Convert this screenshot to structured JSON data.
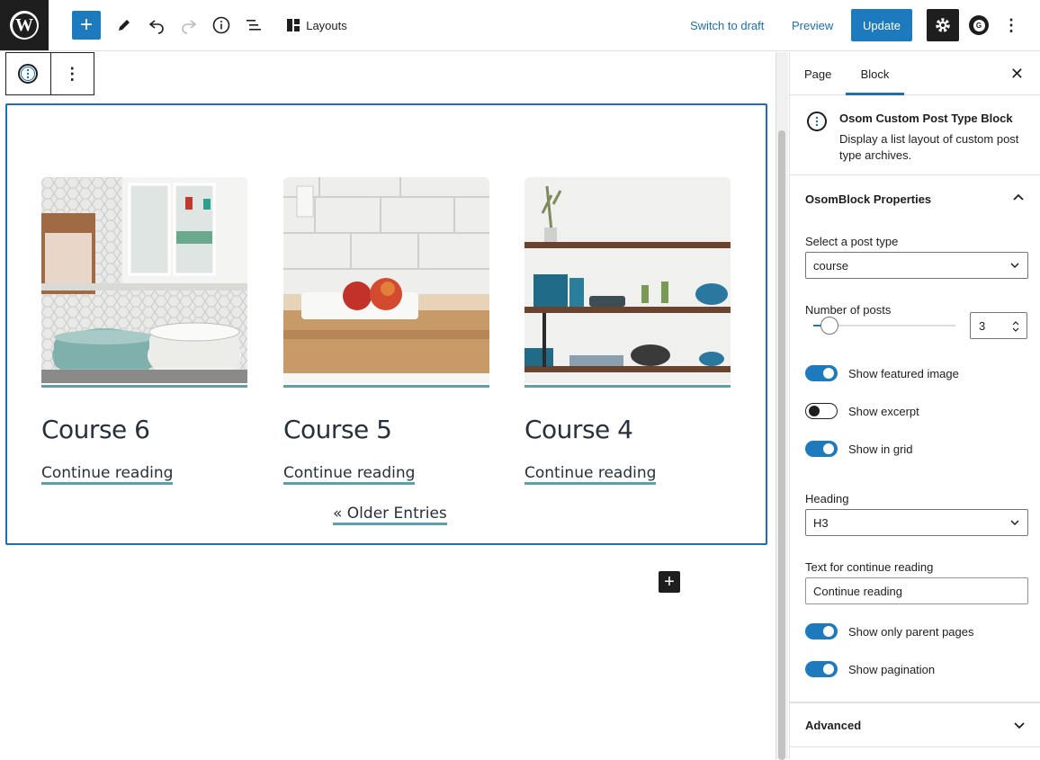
{
  "toolbar": {
    "layouts_label": "Layouts",
    "switch_to_draft": "Switch to draft",
    "preview": "Preview",
    "update": "Update",
    "avatar_letter": "G"
  },
  "posts": [
    {
      "title": "Course 6",
      "more": "Continue reading",
      "image": "kitchen-pots"
    },
    {
      "title": "Course 5",
      "more": "Continue reading",
      "image": "apples-counter"
    },
    {
      "title": "Course 4",
      "more": "Continue reading",
      "image": "open-shelves"
    }
  ],
  "pagination": {
    "older": "« Older Entries"
  },
  "sidebar": {
    "tabs": {
      "page": "Page",
      "block": "Block"
    },
    "block_title": "Osom Custom Post Type Block",
    "block_desc": "Display a list layout of custom post type archives.",
    "properties_title": "OsomBlock Properties",
    "post_type_label": "Select a post type",
    "post_type_value": "course",
    "num_posts_label": "Number of posts",
    "num_posts_value": "3",
    "toggles": [
      {
        "label": "Show featured image",
        "on": true
      },
      {
        "label": "Show excerpt",
        "on": false
      },
      {
        "label": "Show in grid",
        "on": true
      }
    ],
    "heading_label": "Heading",
    "heading_value": "H3",
    "continue_label": "Text for continue reading",
    "continue_value": "Continue reading",
    "toggles2": [
      {
        "label": "Show only parent pages",
        "on": true
      },
      {
        "label": "Show pagination",
        "on": true
      }
    ],
    "advanced": "Advanced"
  },
  "colors": {
    "accent": "#1d7bbd",
    "underline": "#5fa0a8"
  }
}
